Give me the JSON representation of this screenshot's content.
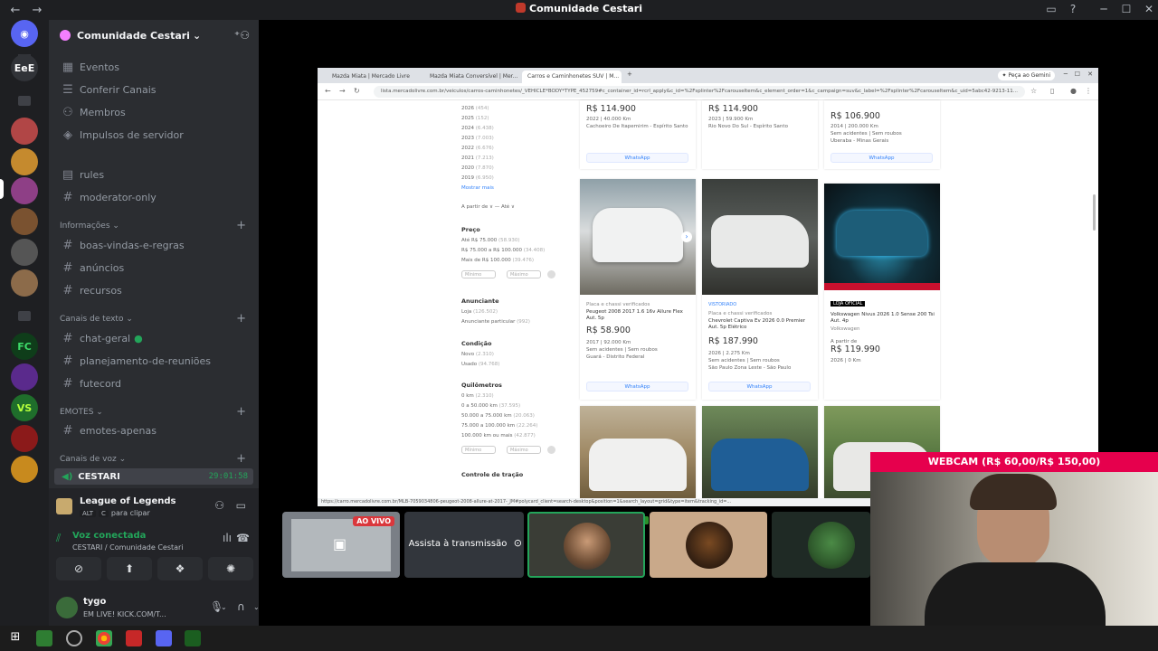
{
  "window": {
    "title": "Comunidade Cestari"
  },
  "guilds": {
    "ee_label": "EeE",
    "fc_label": "FC",
    "vs_label": "VS"
  },
  "server": {
    "name": "Comunidade Cestari"
  },
  "menu": [
    "Eventos",
    "Conferir Canais",
    "Membros",
    "Impulsos de servidor"
  ],
  "top_channels": [
    "rules",
    "moderator-only"
  ],
  "categories": {
    "info": "Informações",
    "text": "Canais de texto",
    "emotes": "EMOTES",
    "voice": "Canais de voz"
  },
  "info_channels": [
    "boas-vindas-e-regras",
    "anúncios",
    "recursos"
  ],
  "text_channels": [
    "chat-geral",
    "planejamento-de-reuniões",
    "futecord"
  ],
  "emote_channels": [
    "emotes-apenas"
  ],
  "voice_channel": {
    "name": "CESTARI",
    "timer": "29:01:58"
  },
  "activity": {
    "name": "League of Legends",
    "key1": "ALT",
    "key2": "C",
    "hint": "para clipar"
  },
  "voice_status": {
    "label": "Voz conectada",
    "location": "CESTARI / Comunidade Cestari"
  },
  "user": {
    "name": "tygo",
    "status": "EM LIVE! KICK.COM/T..."
  },
  "browser": {
    "tabs": [
      "Mazda Miata | Mercado Livre",
      "Mazda Miata Conversível | Mer...",
      "Carros e Caminhonetes SUV | M..."
    ],
    "gemini": "Peça ao Gemini",
    "url": "lista.mercadolivre.com.br/veiculos/carros-caminhonetes/_VEHICLE*BODY*TYPE_452759#c_container_id=rcrl_apply&c_id=%2Fsplinter%2Fcarouseltem&c_element_order=1&c_campaign=suv&c_label=%2Fsplinter%2Fcarouseltem&c_uid=5abc42-9213-11...",
    "status_url": "https://carro.mercadolivre.com.br/MLB-7059034806-peugeot-2008-allure-at-2017-_JM#polycard_client=search-desktop&position=1&search_layout=grid&type=item&tracking_id=..."
  },
  "filters": {
    "years": [
      {
        "label": "2026",
        "count": "(454)"
      },
      {
        "label": "2025",
        "count": "(152)"
      },
      {
        "label": "2024",
        "count": "(6.438)"
      },
      {
        "label": "2023",
        "count": "(7.003)"
      },
      {
        "label": "2022",
        "count": "(6.676)"
      },
      {
        "label": "2021",
        "count": "(7.213)"
      },
      {
        "label": "2020",
        "count": "(7.870)"
      },
      {
        "label": "2019",
        "count": "(6.950)"
      }
    ],
    "more": "Mostrar mais",
    "range": "A partir de ∨  —  Até ∨",
    "price_title": "Preço",
    "prices": [
      {
        "label": "Até R$ 75.000",
        "count": "(58.930)"
      },
      {
        "label": "R$ 75.000 a R$ 100.000",
        "count": "(34.408)"
      },
      {
        "label": "Mais de R$ 100.000",
        "count": "(39.476)"
      }
    ],
    "min": "Mínimo",
    "max": "Máximo",
    "seller_title": "Anunciante",
    "sellers": [
      {
        "label": "Loja",
        "count": "(126.502)"
      },
      {
        "label": "Anunciante particular",
        "count": "(992)"
      }
    ],
    "cond_title": "Condição",
    "conds": [
      {
        "label": "Novo",
        "count": "(2.310)"
      },
      {
        "label": "Usado",
        "count": "(94.768)"
      }
    ],
    "km_title": "Quilômetros",
    "kms": [
      {
        "label": "0 km",
        "count": "(2.310)"
      },
      {
        "label": "0 a 50.000 km",
        "count": "(37.595)"
      },
      {
        "label": "50.000 a 75.000 km",
        "count": "(20.063)"
      },
      {
        "label": "75.000 a 100.000 km",
        "count": "(22.264)"
      },
      {
        "label": "100.000 km ou mais",
        "count": "(42.877)"
      }
    ],
    "traction_title": "Controle de tração"
  },
  "top_cards": [
    {
      "price": "R$ 114.900",
      "info": "2022 | 40.000 Km",
      "loc": "Cachoeiro De Itapemirim - Espírito Santo",
      "wa": "WhatsApp"
    },
    {
      "price": "R$ 114.900",
      "info": "2023 | 59.900 Km",
      "loc": "Rio Novo Do Sul - Espírito Santo",
      "wa": ""
    },
    {
      "price": "R$ 106.900",
      "info": "2014 | 200.000 Km",
      "loc": "Sem acidentes | Sem roubos",
      "loc2": "Uberaba - Minas Gerais",
      "wa": "WhatsApp"
    }
  ],
  "mid_cards": [
    {
      "badge": "Placa e chassi verificados",
      "title": "Peugeot 2008 2017 1.6 16v Allure Flex Aut. 5p",
      "price": "R$ 58.900",
      "info": "2017 | 92.000 Km",
      "extra": "Sem acidentes | Sem roubos",
      "loc": "Guará - Distrito Federal",
      "wa": "WhatsApp",
      "color": "#cfd3d6"
    },
    {
      "badge": "VISTORIADO",
      "badge2": "Placa e chassi verificados",
      "title": "Chevrolet Captiva Ev 2026 0.0 Premier Aut. 5p Elétrico",
      "price": "R$ 187.990",
      "info": "2026 | 2.275 Km",
      "extra": "Sem acidentes | Sem roubos",
      "loc": "São Paulo Zona Leste - São Paulo",
      "wa": "WhatsApp",
      "color": "#7b7e80"
    },
    {
      "badge": "LOJA OFICIAL",
      "title": "Volkswagen Nivus 2026 1.0 Sense 200 Tsi Aut. 4p",
      "brand": "Volkswagen",
      "pre": "A partir de",
      "price": "R$ 119.990",
      "info": "2026 | 0 Km",
      "color": "#1c3440"
    }
  ],
  "tiles": {
    "live": "AO VIVO",
    "watch": "Assista à transmissão"
  },
  "webcam": {
    "label": "WEBCAM (R$ 60,00/R$ 150,00)"
  }
}
